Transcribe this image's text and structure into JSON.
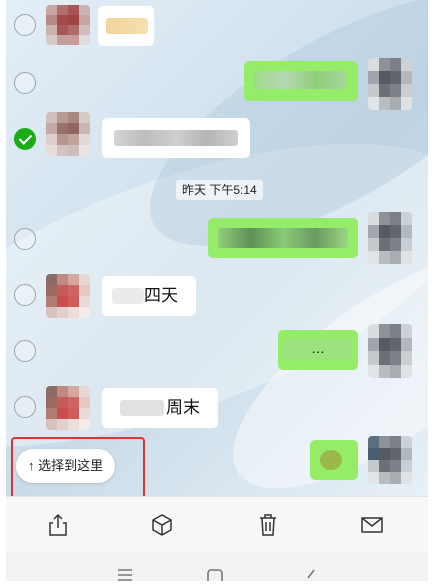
{
  "timestamp": "昨天 下午5:14",
  "select_here_label": "↑ 选择到这里",
  "messages": [
    {
      "side": "in",
      "text": "",
      "selected": false
    },
    {
      "side": "out",
      "text": "",
      "selected": false
    },
    {
      "side": "in",
      "text": "",
      "selected": true
    },
    {
      "side": "out",
      "text": "",
      "selected": false
    },
    {
      "side": "in",
      "text": "四天",
      "selected": false
    },
    {
      "side": "out",
      "text": "…",
      "selected": false
    },
    {
      "side": "in",
      "text": "周末",
      "selected": false
    },
    {
      "side": "out",
      "text": "",
      "selected": false
    }
  ],
  "toolbar": [
    {
      "name": "share-icon"
    },
    {
      "name": "favorite-box-icon"
    },
    {
      "name": "delete-icon"
    },
    {
      "name": "mail-icon"
    }
  ],
  "navbar": [
    {
      "name": "menu-icon"
    },
    {
      "name": "home-icon"
    },
    {
      "name": "back-icon"
    }
  ],
  "colors": {
    "outgoing_bubble": "#95ec69",
    "incoming_bubble": "#ffffff",
    "checkbox_selected": "#1aad19",
    "highlight_box": "#e0332f"
  }
}
